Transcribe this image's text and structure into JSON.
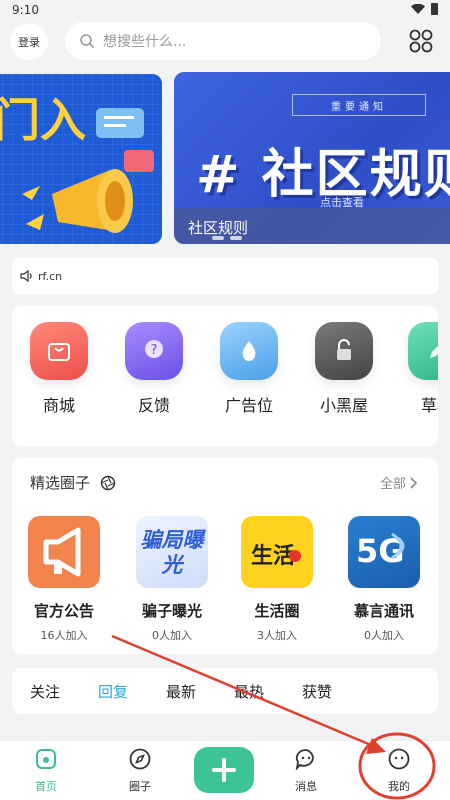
{
  "status_bar": {
    "time": "9:10"
  },
  "top_bar": {
    "login_label": "登录",
    "search_placeholder": "想搜些什么..."
  },
  "banner": {
    "left_text": "门入",
    "right": {
      "notice_label": "重要通知",
      "big_text": "# 社区规则",
      "click_text": "点击查看",
      "caption": "社区规则"
    }
  },
  "notice": {
    "text": "rf.cn"
  },
  "quick_links": [
    {
      "label": "商城",
      "icon": "shopping-bag-icon",
      "color": "#f46a60"
    },
    {
      "label": "反馈",
      "icon": "question-icon",
      "color": "#8a6cf3"
    },
    {
      "label": "广告位",
      "icon": "water-drop-icon",
      "color": "#6ab3f0"
    },
    {
      "label": "小黑屋",
      "icon": "padlock-icon",
      "color": "#5a5a5a"
    },
    {
      "label": "草稿",
      "icon": "pen-icon",
      "color": "#3cc89a"
    }
  ],
  "circles": {
    "title": "精选圈子",
    "all_label": "全部",
    "items": [
      {
        "name": "官方公告",
        "count": "16人加入",
        "icon": "megaphone-icon",
        "icon_text": ""
      },
      {
        "name": "骗子曝光",
        "count": "0人加入",
        "icon": "scam-exposure-icon",
        "icon_text": "骗局曝光"
      },
      {
        "name": "生活圈",
        "count": "3人加入",
        "icon": "life-icon",
        "icon_text": "生活"
      },
      {
        "name": "慕言通讯",
        "count": "0人加入",
        "icon": "5g-icon",
        "icon_text": "5G"
      }
    ]
  },
  "feed_tabs": [
    {
      "label": "关注",
      "active": false
    },
    {
      "label": "回复",
      "active": true
    },
    {
      "label": "最新",
      "active": false
    },
    {
      "label": "最热",
      "active": false
    },
    {
      "label": "获赞",
      "active": false
    }
  ],
  "bottom_nav": {
    "home": "首页",
    "circles": "圈子",
    "messages": "消息",
    "mine": "我的"
  },
  "colors": {
    "accent_green": "#3cc494",
    "tab_active": "#2aa8d8",
    "annotation_red": "#e0412f"
  }
}
